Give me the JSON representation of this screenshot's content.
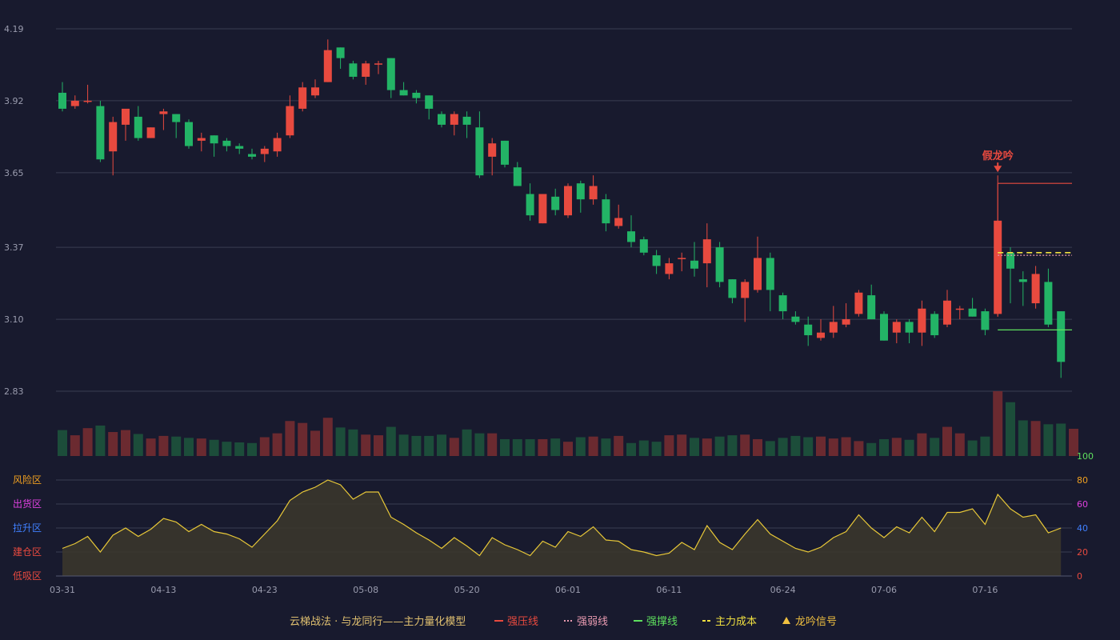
{
  "colors": {
    "background": "#181a2e",
    "grid": "#3a3d52",
    "up": "#e84a3f",
    "down": "#23b466",
    "vol_up": "#6b2a30",
    "vol_down": "#1c4d3a",
    "osc_line": "#e8c838",
    "osc_fill": "#3a362c",
    "axis_text": "#9a9cae",
    "resistance": "#e84a3f",
    "weak": "#e89ab0",
    "support": "#5ee05e",
    "cost": "#f0e040",
    "signal": "#f0c040",
    "title_text": "#e0c070"
  },
  "chart_data": [
    {
      "type": "candlestick",
      "title": "",
      "ylim": [
        2.83,
        4.19
      ],
      "yticks": [
        "4.19",
        "3.92",
        "3.65",
        "3.37",
        "3.10",
        "2.83"
      ],
      "xticks": [
        "03-31",
        "04-13",
        "04-23",
        "05-08",
        "05-20",
        "06-01",
        "06-11",
        "06-24",
        "07-06",
        "07-16"
      ],
      "xtick_indices": [
        0,
        8,
        16,
        24,
        32,
        40,
        48,
        57,
        65,
        73
      ],
      "candles": [
        [
          3.95,
          3.99,
          3.89,
          3.88
        ],
        [
          3.9,
          3.94,
          3.92,
          3.89
        ],
        [
          3.92,
          3.98,
          3.92,
          3.91
        ],
        [
          3.9,
          3.92,
          3.7,
          3.69
        ],
        [
          3.73,
          3.86,
          3.84,
          3.64
        ],
        [
          3.83,
          3.88,
          3.89,
          3.77
        ],
        [
          3.86,
          3.9,
          3.78,
          3.77
        ],
        [
          3.78,
          3.82,
          3.82,
          3.78
        ],
        [
          3.87,
          3.89,
          3.88,
          3.81
        ],
        [
          3.87,
          3.87,
          3.84,
          3.78
        ],
        [
          3.84,
          3.85,
          3.75,
          3.74
        ],
        [
          3.77,
          3.8,
          3.78,
          3.73
        ],
        [
          3.79,
          3.79,
          3.76,
          3.71
        ],
        [
          3.77,
          3.78,
          3.75,
          3.73
        ],
        [
          3.75,
          3.76,
          3.74,
          3.72
        ],
        [
          3.72,
          3.74,
          3.71,
          3.7
        ],
        [
          3.72,
          3.75,
          3.74,
          3.69
        ],
        [
          3.73,
          3.8,
          3.78,
          3.71
        ],
        [
          3.79,
          3.94,
          3.9,
          3.78
        ],
        [
          3.89,
          3.99,
          3.97,
          3.88
        ],
        [
          3.94,
          4.0,
          3.97,
          3.93
        ],
        [
          3.99,
          4.15,
          4.11,
          3.99
        ],
        [
          4.12,
          4.12,
          4.08,
          4.04
        ],
        [
          4.06,
          4.07,
          4.01,
          4.0
        ],
        [
          4.01,
          4.07,
          4.06,
          3.98
        ],
        [
          4.06,
          4.07,
          4.06,
          4.02
        ],
        [
          4.08,
          4.08,
          3.96,
          3.93
        ],
        [
          3.96,
          3.99,
          3.94,
          3.94
        ],
        [
          3.95,
          3.96,
          3.93,
          3.91
        ],
        [
          3.94,
          3.94,
          3.89,
          3.85
        ],
        [
          3.87,
          3.88,
          3.83,
          3.82
        ],
        [
          3.83,
          3.88,
          3.87,
          3.79
        ],
        [
          3.86,
          3.88,
          3.83,
          3.78
        ],
        [
          3.82,
          3.88,
          3.64,
          3.63
        ],
        [
          3.71,
          3.78,
          3.76,
          3.64
        ],
        [
          3.77,
          3.77,
          3.68,
          3.67
        ],
        [
          3.67,
          3.69,
          3.6,
          3.6
        ],
        [
          3.57,
          3.61,
          3.49,
          3.47
        ],
        [
          3.46,
          3.57,
          3.57,
          3.46
        ],
        [
          3.56,
          3.59,
          3.51,
          3.49
        ],
        [
          3.49,
          3.61,
          3.6,
          3.48
        ],
        [
          3.61,
          3.62,
          3.55,
          3.5
        ],
        [
          3.55,
          3.64,
          3.6,
          3.53
        ],
        [
          3.55,
          3.57,
          3.46,
          3.43
        ],
        [
          3.45,
          3.53,
          3.48,
          3.44
        ],
        [
          3.43,
          3.49,
          3.39,
          3.37
        ],
        [
          3.4,
          3.41,
          3.35,
          3.34
        ],
        [
          3.34,
          3.36,
          3.3,
          3.27
        ],
        [
          3.27,
          3.33,
          3.31,
          3.25
        ],
        [
          3.33,
          3.35,
          3.33,
          3.28
        ],
        [
          3.32,
          3.39,
          3.29,
          3.26
        ],
        [
          3.31,
          3.46,
          3.4,
          3.22
        ],
        [
          3.37,
          3.39,
          3.24,
          3.22
        ],
        [
          3.25,
          3.25,
          3.18,
          3.16
        ],
        [
          3.18,
          3.25,
          3.24,
          3.09
        ],
        [
          3.21,
          3.41,
          3.33,
          3.2
        ],
        [
          3.33,
          3.35,
          3.21,
          3.13
        ],
        [
          3.19,
          3.2,
          3.13,
          3.1
        ],
        [
          3.11,
          3.13,
          3.09,
          3.08
        ],
        [
          3.08,
          3.11,
          3.04,
          3.0
        ],
        [
          3.03,
          3.1,
          3.05,
          3.02
        ],
        [
          3.05,
          3.15,
          3.09,
          3.03
        ],
        [
          3.08,
          3.16,
          3.1,
          3.07
        ],
        [
          3.12,
          3.21,
          3.2,
          3.11
        ],
        [
          3.19,
          3.23,
          3.1,
          3.1
        ],
        [
          3.12,
          3.13,
          3.02,
          3.02
        ],
        [
          3.05,
          3.1,
          3.09,
          3.01
        ],
        [
          3.09,
          3.1,
          3.05,
          3.01
        ],
        [
          3.05,
          3.17,
          3.14,
          3.0
        ],
        [
          3.12,
          3.13,
          3.04,
          3.03
        ],
        [
          3.08,
          3.21,
          3.17,
          3.07
        ],
        [
          3.14,
          3.15,
          3.14,
          3.1
        ],
        [
          3.14,
          3.18,
          3.11,
          3.11
        ],
        [
          3.13,
          3.14,
          3.06,
          3.04
        ],
        [
          3.12,
          3.64,
          3.47,
          3.11
        ],
        [
          3.35,
          3.37,
          3.29,
          3.16
        ],
        [
          3.25,
          3.28,
          3.24,
          3.15
        ],
        [
          3.16,
          3.3,
          3.27,
          3.14
        ],
        [
          3.24,
          3.29,
          3.08,
          3.07
        ],
        [
          3.13,
          3.13,
          2.94,
          2.88
        ]
      ],
      "resistance": {
        "start": 74,
        "value": 3.61
      },
      "weak": {
        "start": 74,
        "value": 3.34
      },
      "support": {
        "start": 74,
        "value": 3.06
      },
      "cost": {
        "start": 74,
        "value": 3.35
      },
      "signal": {
        "index": 74,
        "label": "假龙吟"
      }
    },
    {
      "type": "bar",
      "title": "",
      "values": [
        40,
        32,
        43,
        47,
        37,
        40,
        34,
        27,
        31,
        30,
        28,
        27,
        25,
        22,
        21,
        20,
        29,
        35,
        54,
        51,
        39,
        59,
        44,
        41,
        33,
        32,
        45,
        33,
        31,
        31,
        33,
        28,
        41,
        35,
        35,
        26,
        26,
        26,
        26,
        27,
        22,
        29,
        30,
        27,
        31,
        20,
        24,
        22,
        32,
        33,
        28,
        27,
        30,
        32,
        33,
        26,
        23,
        28,
        31,
        29,
        30,
        27,
        29,
        23,
        20,
        26,
        28,
        25,
        35,
        28,
        45,
        35,
        24,
        30,
        100,
        83,
        55,
        54,
        49,
        50,
        42
      ],
      "ylim": [
        0,
        100
      ]
    },
    {
      "type": "area",
      "title": "",
      "ylim": [
        0,
        100
      ],
      "yticks": [
        "100",
        "80",
        "60",
        "40",
        "20",
        "0"
      ],
      "zones": [
        "风险区",
        "出货区",
        "拉升区",
        "建仓区",
        "低吸区"
      ],
      "values": [
        23,
        27,
        33,
        20,
        34,
        40,
        33,
        39,
        48,
        45,
        37,
        43,
        37,
        35,
        31,
        24,
        35,
        46,
        63,
        70,
        74,
        80,
        76,
        64,
        70,
        70,
        49,
        43,
        36,
        30,
        23,
        32,
        25,
        17,
        32,
        26,
        22,
        17,
        29,
        24,
        37,
        33,
        41,
        30,
        29,
        22,
        20,
        17,
        19,
        28,
        22,
        42,
        28,
        22,
        35,
        47,
        35,
        29,
        23,
        20,
        24,
        32,
        37,
        51,
        40,
        32,
        41,
        36,
        49,
        37,
        53,
        53,
        56,
        43,
        68,
        56,
        49,
        51,
        36,
        40
      ]
    }
  ],
  "legend": {
    "title": "云梯战法 · 与龙同行——主力量化模型",
    "items": [
      {
        "label": "强压线",
        "color": "#e84a3f",
        "style": "solid"
      },
      {
        "label": "强弱线",
        "color": "#e89ab0",
        "style": "dotted"
      },
      {
        "label": "强撑线",
        "color": "#5ee05e",
        "style": "solid"
      },
      {
        "label": "主力成本",
        "color": "#f0e040",
        "style": "dashed"
      },
      {
        "label": "龙吟信号",
        "color": "#f0c040",
        "style": "triangle"
      }
    ]
  }
}
